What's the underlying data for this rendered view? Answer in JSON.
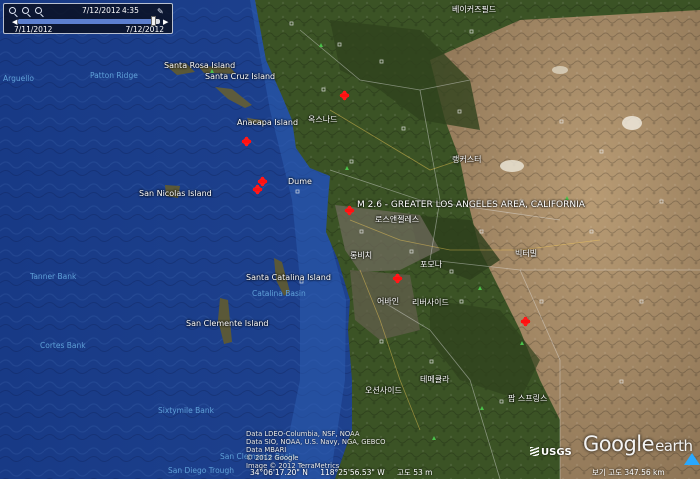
{
  "time_slider": {
    "current_date": "7/12/2012",
    "current_time": "4:35",
    "start_date": "7/11/2012",
    "end_date": "7/12/2012",
    "position": 0.96
  },
  "earthquakes": [
    {
      "label": "M 2.6 - GREATER LOS ANGELES AREA, CALIFORNIA"
    }
  ],
  "place_labels": {
    "santa_rosa_island": "Santa Rosa Island",
    "santa_cruz_island": "Santa Cruz Island",
    "anacapa_island": "Anacapa Island",
    "san_nicolas_island": "San Nicolas Island",
    "santa_catalina_island": "Santa Catalina Island",
    "catalina_basin": "Catalina Basin",
    "san_clemente_island": "San Clemente Island",
    "dume": "Dume",
    "greater_la_quake": "M 2.6 - GREATER LOS ANGELES AREA, CALIFORNIA",
    "bakersfield": "베이커즈필드",
    "oxnard": "옥스나드",
    "lancaster": "랭커스터",
    "los_angeles": "로스앤젤레스",
    "long_beach": "롱비치",
    "pomona": "포모나",
    "irvine": "어바인",
    "riverside": "리버사이드",
    "victorville": "빅터빌",
    "temecula": "테메큘라",
    "oceanside": "오션사이드",
    "palm_springs": "팜 스프링스"
  },
  "water_labels": {
    "patton_ridge": "Patton Ridge",
    "arguello": "Arguello",
    "tanner_bank": "Tanner Bank",
    "cortes_bank": "Cortes Bank",
    "sixtymile_bank": "Sixtymile Bank",
    "catalina_basin": "Catalina Basin",
    "san_clemente_basin": "San Clemente Basin",
    "san_diego_trough": "San Diego Trough"
  },
  "attribution": {
    "credits_line1": "Data SIO, NOAA, U.S. Navy, NGA, GEBCO",
    "credits_line2": "Data LDEO-Columbia, NSF, NOAA",
    "credits_line3": "Data MBARI",
    "credits_line4": "© 2012 Google",
    "credits_line5": "Image © 2012 TerraMetrics",
    "usgs": "USGS",
    "google": "Google",
    "earth": "earth"
  },
  "status_bar": {
    "lat": "34°06'17.20\" N",
    "lon": "118°25'56.53\" W",
    "elev": "고도   53 m",
    "eye_alt": "보기 고도  347.56 km"
  },
  "colors": {
    "ocean": "#1f4390",
    "ocean_deep": "#142e6e",
    "land_green": "#3c5524",
    "desert": "#a28a66",
    "quake": "#ff1a1a"
  }
}
